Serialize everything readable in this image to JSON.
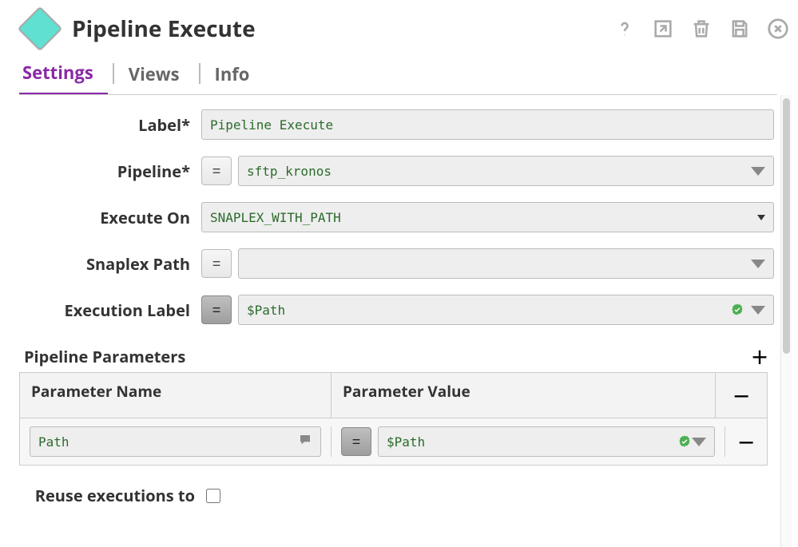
{
  "header": {
    "title": "Pipeline Execute"
  },
  "tabs": {
    "settings": "Settings",
    "views": "Views",
    "info": "Info",
    "active": "settings"
  },
  "fields": {
    "label": {
      "label": "Label*",
      "value": "Pipeline Execute"
    },
    "pipeline": {
      "label": "Pipeline*",
      "value": "sftp_kronos"
    },
    "executeOn": {
      "label": "Execute On",
      "value": "SNAPLEX_WITH_PATH"
    },
    "snaplexPath": {
      "label": "Snaplex Path",
      "value": ""
    },
    "executionLabel": {
      "label": "Execution Label",
      "value": "$Path"
    }
  },
  "parameters": {
    "title": "Pipeline Parameters",
    "columns": {
      "name": "Parameter Name",
      "value": "Parameter Value"
    },
    "rows": [
      {
        "name": "Path",
        "value": "$Path"
      }
    ]
  },
  "reuse": {
    "label": "Reuse executions to",
    "checked": false
  }
}
